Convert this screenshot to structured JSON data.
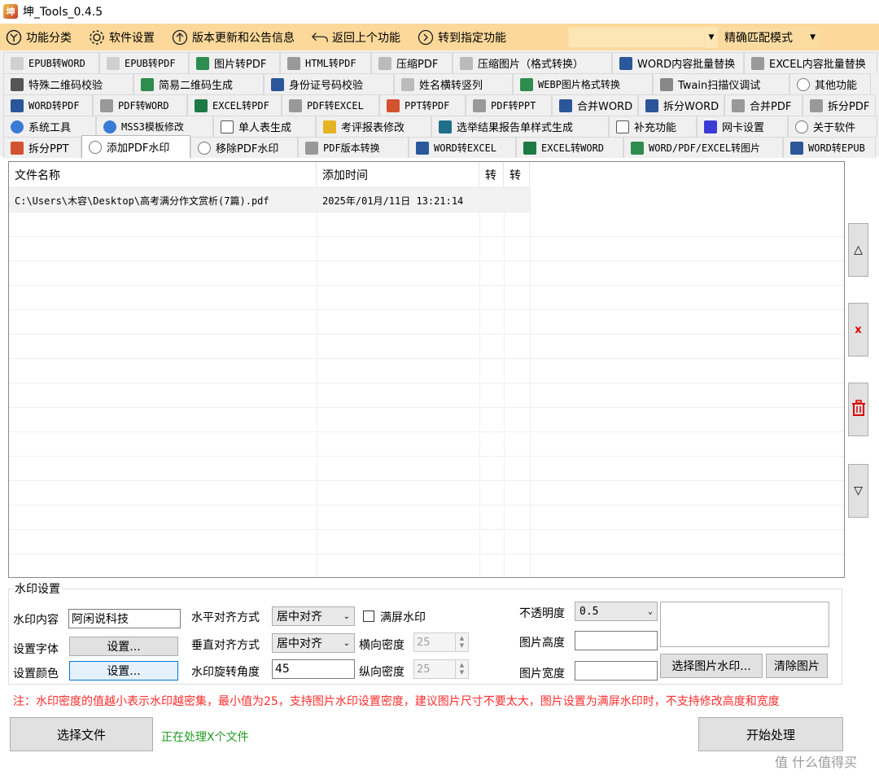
{
  "window": {
    "title": "坤_Tools_0.4.5"
  },
  "toolbar": {
    "category": "功能分类",
    "settings": "软件设置",
    "update": "版本更新和公告信息",
    "back": "返回上个功能",
    "goto": "转到指定功能",
    "search_value": "",
    "match_mode": "精确匹配模式"
  },
  "tabs": {
    "row1": [
      "EPUB转WORD",
      "EPUB转PDF",
      "图片转PDF",
      "HTML转PDF",
      "压缩PDF",
      "压缩图片（格式转换）",
      "WORD内容批量替换",
      "EXCEL内容批量替换"
    ],
    "row2": [
      "特殊二维码校验",
      "简易二维码生成",
      "身份证号码校验",
      "姓名横转竖列",
      "WEBP图片格式转换",
      "Twain扫描仪调试",
      "其他功能"
    ],
    "row3": [
      "WORD转PDF",
      "PDF转WORD",
      "EXCEL转PDF",
      "PDF转EXCEL",
      "PPT转PDF",
      "PDF转PPT",
      "合并WORD",
      "拆分WORD",
      "合并PDF",
      "拆分PDF"
    ],
    "row4": [
      "系统工具",
      "MSS3模板修改",
      "单人表生成",
      "考评报表修改",
      "选举结果报告单样式生成",
      "补充功能",
      "网卡设置",
      "关于软件"
    ],
    "row5": [
      "拆分PPT",
      "添加PDF水印",
      "移除PDF水印",
      "PDF版本转换",
      "WORD转EXCEL",
      "EXCEL转WORD",
      "WORD/PDF/EXCEL转图片",
      "WORD转EPUB"
    ]
  },
  "file_list": {
    "headers": [
      "文件名称",
      "添加时间",
      "转",
      "转"
    ],
    "rows": [
      {
        "name": "C:\\Users\\木容\\Desktop\\高考满分作文赏析(7篇).pdf",
        "time": "2025年/01月/11日 13:21:14",
        "c3": "",
        "c4": ""
      }
    ]
  },
  "side_buttons": {
    "up": "△",
    "delete": "x",
    "clear": "",
    "down": "▽"
  },
  "watermark_settings": {
    "group_title": "水印设置",
    "content_label": "水印内容",
    "content_value": "阿闲说科技",
    "font_label": "设置字体",
    "font_button": "设置...",
    "color_label": "设置颜色",
    "color_button": "设置...",
    "h_align_label": "水平对齐方式",
    "h_align_value": "居中对齐",
    "v_align_label": "垂直对齐方式",
    "v_align_value": "居中对齐",
    "rotation_label": "水印旋转角度",
    "rotation_value": "45",
    "fullscreen_label": "满屏水印",
    "h_density_label": "横向密度",
    "h_density_value": "25",
    "v_density_label": "纵向密度",
    "v_density_value": "25",
    "opacity_label": "不透明度",
    "opacity_value": "0.5",
    "img_height_label": "图片高度",
    "img_height_value": "",
    "img_width_label": "图片宽度",
    "img_width_value": "",
    "choose_image_button": "选择图片水印...",
    "clear_image_button": "清除图片"
  },
  "note": "注：水印密度的值越小表示水印越密集，最小值为25，支持图片水印设置密度，建议图片尺寸不要太大，图片设置为满屏水印时，不支持修改高度和宽度",
  "actions": {
    "choose_file": "选择文件",
    "status": "正在处理X个文件",
    "start": "开始处理"
  },
  "footer_watermark": "值 什么值得买",
  "colors": {
    "toolbar_bg": "#fcd99a",
    "note": "#ff2b2b",
    "status": "#1f9b1f",
    "list_border": "#828790"
  }
}
